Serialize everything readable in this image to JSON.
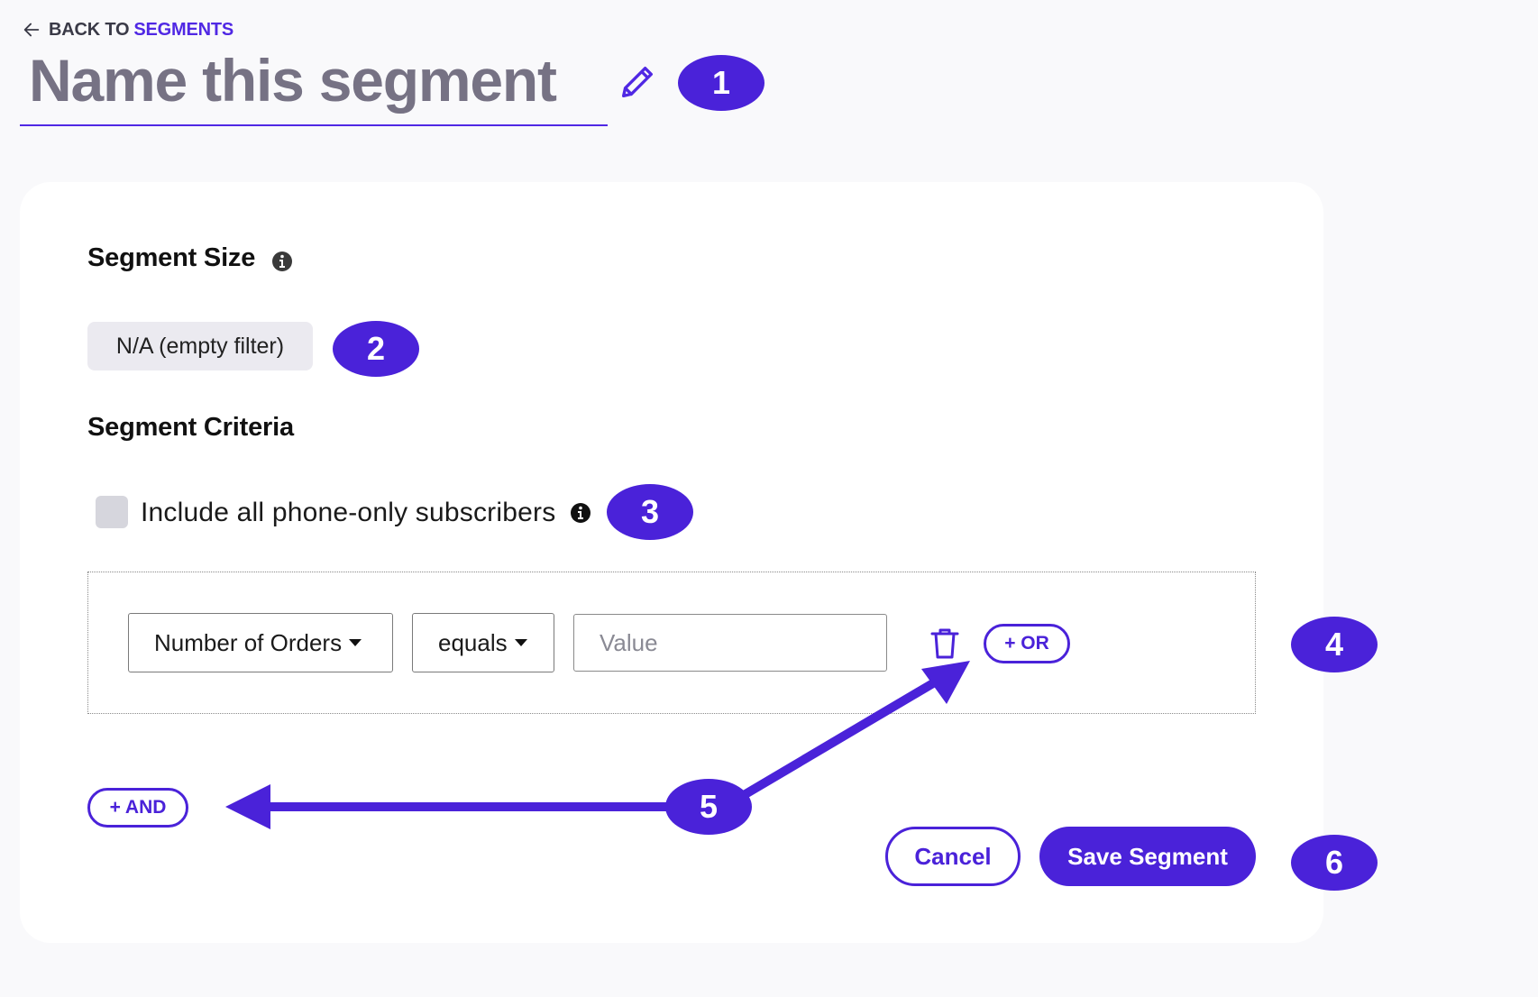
{
  "header": {
    "back_prefix": "BACK TO",
    "back_link": "SEGMENTS",
    "title": "Name this segment"
  },
  "segment_size": {
    "heading": "Segment Size",
    "value": "N/A (empty filter)"
  },
  "segment_criteria": {
    "heading": "Segment Criteria",
    "checkbox_label": "Include all phone-only subscribers",
    "checkbox_checked": false,
    "rule": {
      "field": "Number of Orders",
      "operator": "equals",
      "value": "",
      "value_placeholder": "Value"
    },
    "or_button": "+ OR",
    "and_button": "+ AND"
  },
  "actions": {
    "cancel": "Cancel",
    "save": "Save Segment"
  },
  "callouts": [
    "1",
    "2",
    "3",
    "4",
    "5",
    "6"
  ],
  "colors": {
    "accent": "#4a22d9",
    "title_gray": "#767284",
    "pill_bg": "#ebeaf0",
    "page_bg": "#f9f9fb"
  },
  "icons": [
    "arrow-left-icon",
    "pencil-icon",
    "info-icon",
    "trash-icon",
    "caret-down-icon"
  ]
}
